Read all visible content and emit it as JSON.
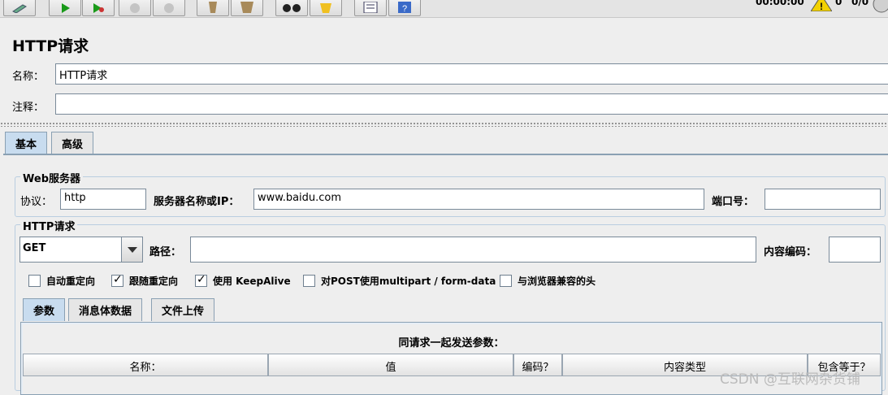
{
  "toolbar": {
    "buttons": [
      "edit-icon",
      "start-icon",
      "start-no-pause-icon",
      "stop-icon",
      "shutdown-icon",
      "clear-icon",
      "clear-all-icon",
      "search-icon",
      "reset-search-icon",
      "function-helper-icon",
      "help-icon"
    ],
    "timer": "00:00:00",
    "warning_count": "0",
    "thread_count": "0/0"
  },
  "page": {
    "title": "HTTP请求"
  },
  "form": {
    "name_label": "名称：",
    "name_value": "HTTP请求",
    "comment_label": "注释：",
    "comment_value": ""
  },
  "tabs": {
    "basic": "基本",
    "advanced": "高级"
  },
  "web_server": {
    "group_title": "Web服务器",
    "protocol_label": "协议：",
    "protocol_value": "http",
    "server_label": "服务器名称或IP：",
    "server_value": "www.baidu.com",
    "port_label": "端口号：",
    "port_value": ""
  },
  "http_request": {
    "group_title": "HTTP请求",
    "method": "GET",
    "path_label": "路径：",
    "path_value": "",
    "encoding_label": "内容编码：",
    "encoding_value": ""
  },
  "options": [
    {
      "label": "自动重定向",
      "checked": false
    },
    {
      "label": "跟随重定向",
      "checked": true
    },
    {
      "label": "使用 KeepAlive",
      "checked": true
    },
    {
      "label": "对POST使用multipart / form-data",
      "checked": false
    },
    {
      "label": "与浏览器兼容的头",
      "checked": false
    }
  ],
  "sub_tabs": {
    "params": "参数",
    "body": "消息体数据",
    "files": "文件上传"
  },
  "params_table": {
    "title": "同请求一起发送参数：",
    "columns": [
      "名称：",
      "值",
      "编码？",
      "内容类型",
      "包含等于？"
    ]
  },
  "watermark": "CSDN @互联网杂货铺"
}
